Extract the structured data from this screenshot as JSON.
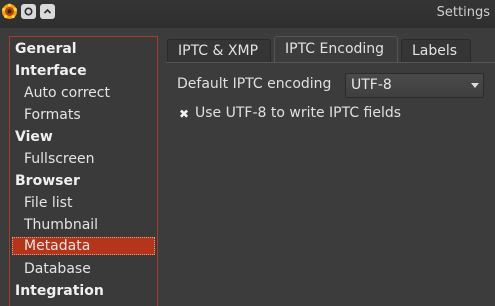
{
  "window": {
    "title": "Settings",
    "buttons": [
      {
        "icon": "close-icon"
      },
      {
        "icon": "chevron-up-icon"
      }
    ]
  },
  "sidebar": {
    "items": [
      {
        "label": "General",
        "kind": "category"
      },
      {
        "label": "Interface",
        "kind": "category"
      },
      {
        "label": "Auto correct",
        "kind": "sub"
      },
      {
        "label": "Formats",
        "kind": "sub"
      },
      {
        "label": "View",
        "kind": "category"
      },
      {
        "label": "Fullscreen",
        "kind": "sub"
      },
      {
        "label": "Browser",
        "kind": "category"
      },
      {
        "label": "File list",
        "kind": "sub"
      },
      {
        "label": "Thumbnail",
        "kind": "sub"
      },
      {
        "label": "Metadata",
        "kind": "sub",
        "selected": true
      },
      {
        "label": "Database",
        "kind": "sub"
      },
      {
        "label": "Integration",
        "kind": "category"
      }
    ]
  },
  "tabs": [
    {
      "label": "IPTC & XMP"
    },
    {
      "label": "IPTC Encoding",
      "active": true
    },
    {
      "label": "Labels"
    }
  ],
  "encoding": {
    "label": "Default IPTC encoding",
    "value": "UTF-8",
    "checkbox_label": "Use UTF-8 to write IPTC fields",
    "checkbox_checked": true,
    "checkbox_glyph": "✖"
  },
  "colors": {
    "accent": "#b5351b",
    "background": "#3c3c3c"
  }
}
